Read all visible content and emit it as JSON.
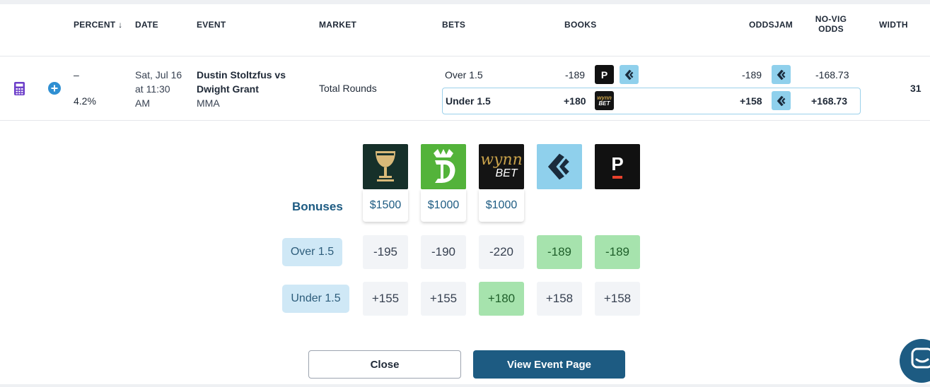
{
  "header": {
    "percent": "PERCENT",
    "sort_arrow": "↓",
    "date": "DATE",
    "event": "EVENT",
    "market": "MARKET",
    "bets": "BETS",
    "books": "BOOKS",
    "oddsjam": "ODDSJAM",
    "novig_line1": "NO-VIG",
    "novig_line2": "ODDS",
    "width": "WIDTH"
  },
  "row": {
    "percent_dash": "–",
    "percent_value": "4.2%",
    "date_line1": "Sat, Jul 16",
    "date_line2": "at 11:30",
    "date_line3": "AM",
    "event_line1": "Dustin Stoltzfus vs",
    "event_line2": "Dwight Grant",
    "sport": "MMA",
    "market": "Total Rounds",
    "over": {
      "bet": "Over 1.5",
      "odds": "-189",
      "oddsjam": "-189",
      "novig": "-168.73"
    },
    "under": {
      "bet": "Under 1.5",
      "odds": "+180",
      "oddsjam": "+158",
      "novig": "+168.73"
    },
    "width": "31"
  },
  "detail": {
    "bonuses_label": "Bonuses",
    "books": [
      {
        "icon": "chalice-book-logo",
        "bonus": "$1500",
        "over": "-195",
        "under": "+155"
      },
      {
        "icon": "draftkings-logo",
        "bonus": "$1000",
        "over": "-190",
        "under": "+155"
      },
      {
        "icon": "wynnbet-logo",
        "bonus": "$1000",
        "over": "-220",
        "under": "+180"
      },
      {
        "icon": "kambi-logo",
        "bonus": "",
        "over": "-189",
        "under": "+158"
      },
      {
        "icon": "pointsbet-logo",
        "bonus": "",
        "over": "-189",
        "under": "+158"
      }
    ],
    "over_label": "Over 1.5",
    "under_label": "Under 1.5",
    "wynn_text1": "wynn",
    "wynn_text2": "BET",
    "p_letter": "P"
  },
  "buttons": {
    "close": "Close",
    "view_event": "View Event Page"
  },
  "colors": {
    "accent": "#1d5b82",
    "highlight": "#a6e3ad",
    "label_bg": "#cfe8f6"
  }
}
